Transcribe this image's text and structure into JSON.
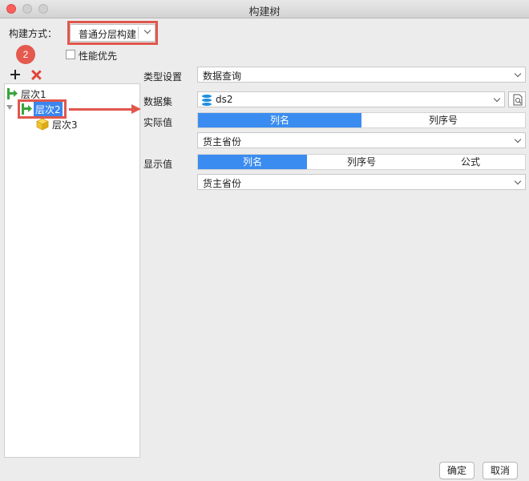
{
  "window": {
    "title": "构建树"
  },
  "build": {
    "label": "构建方式：",
    "mode_value": "普通分层构建",
    "step_badge": "2",
    "performance_label": "性能优先",
    "performance_checked": false
  },
  "colors": {
    "accent": "#3b8cf0",
    "annotation": "#e0574c",
    "selection": "#3b86ee"
  },
  "tree": {
    "nodes": [
      {
        "label": "层次1",
        "icon": "level-icon"
      },
      {
        "label": "层次2",
        "icon": "level-icon",
        "selected": true
      },
      {
        "label": "层次3",
        "icon": "cube-icon"
      }
    ]
  },
  "settings": {
    "type_label": "类型设置",
    "type_value": "数据查询",
    "dataset_label": "数据集",
    "dataset_value": "ds2",
    "actual_label": "实际值",
    "actual_tabs": [
      "列名",
      "列序号"
    ],
    "actual_active": "列名",
    "actual_column": "货主省份",
    "display_label": "显示值",
    "display_tabs": [
      "列名",
      "列序号",
      "公式"
    ],
    "display_active": "列名",
    "display_column": "货主省份"
  },
  "footer": {
    "ok": "确定",
    "cancel": "取消"
  }
}
